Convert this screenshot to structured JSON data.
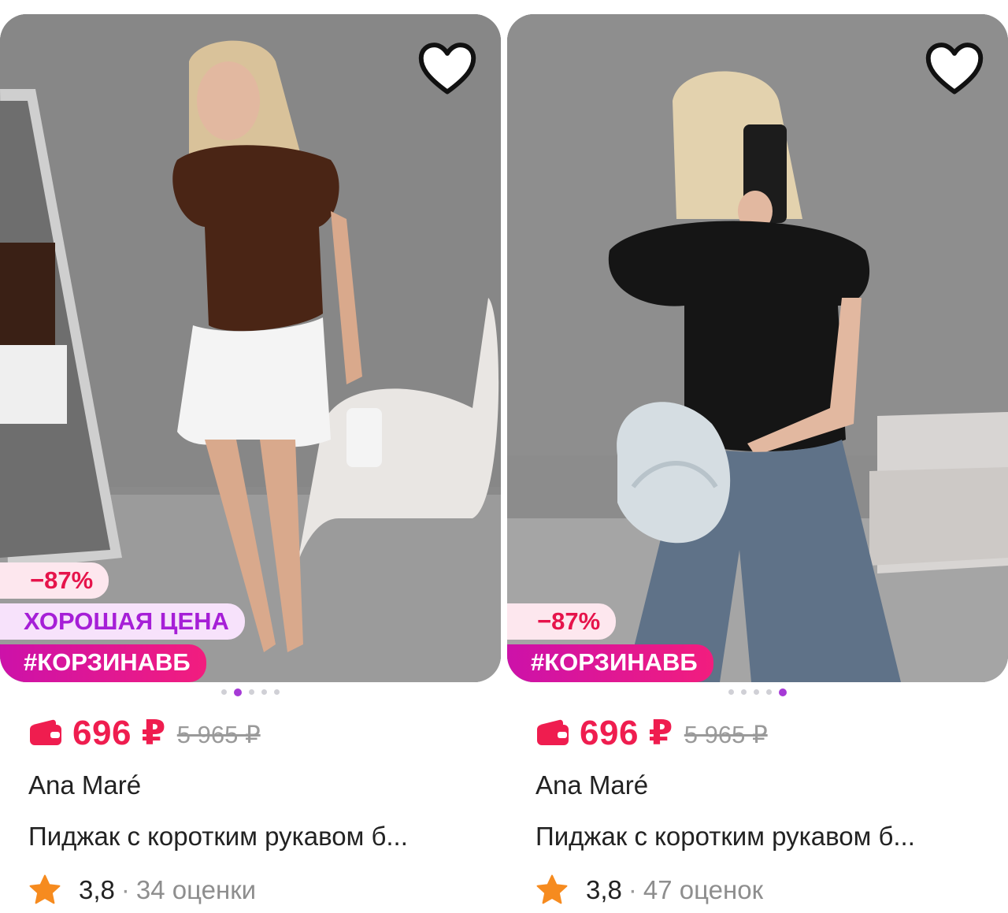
{
  "products": [
    {
      "photo_alt": "Женщина в коричневой блузке и белых шортах",
      "favorite_icon": "heart-outline-icon",
      "badges": {
        "discount": "−87%",
        "good_price": "ХОРОШАЯ ЦЕНА",
        "tag": "#КОРЗИНАВБ"
      },
      "carousel": {
        "total": 5,
        "active_index": 1
      },
      "price": "696 ₽",
      "old_price": "5 965 ₽",
      "brand": "Ana Maré",
      "title": "Пиджак с коротким рукавом б...",
      "rating": "3,8",
      "separator": "·",
      "reviews": "34 оценки"
    },
    {
      "photo_alt": "Женщина в черной блузке и джинсах с сумкой",
      "favorite_icon": "heart-outline-icon",
      "badges": {
        "discount": "−87%",
        "good_price": null,
        "tag": "#КОРЗИНАВБ"
      },
      "carousel": {
        "total": 5,
        "active_index": 4
      },
      "price": "696 ₽",
      "old_price": "5 965 ₽",
      "brand": "Ana Maré",
      "title": "Пиджак с коротким рукавом б...",
      "rating": "3,8",
      "separator": "·",
      "reviews": "47 оценок"
    }
  ],
  "colors": {
    "price": "#ef1d4f",
    "brand_gradient_start": "#cb11ab",
    "brand_gradient_end": "#f21d7e",
    "good_price_text": "#a61fd7",
    "star": "#f68b1f"
  }
}
